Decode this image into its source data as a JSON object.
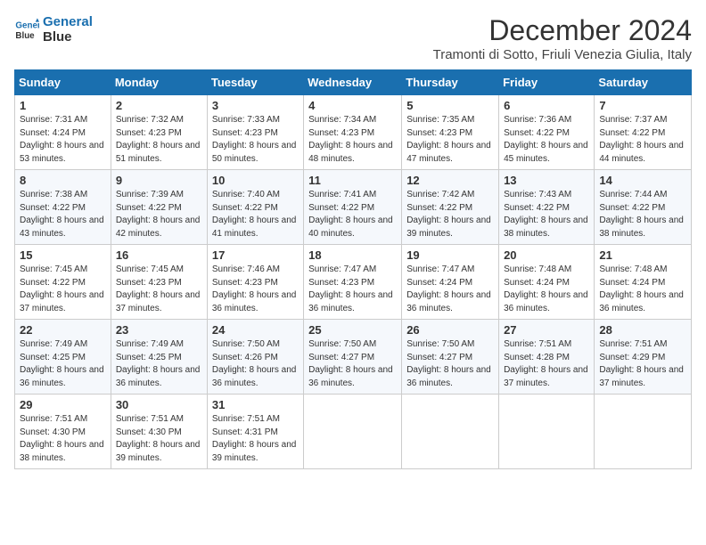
{
  "logo": {
    "line1": "General",
    "line2": "Blue"
  },
  "title": "December 2024",
  "subtitle": "Tramonti di Sotto, Friuli Venezia Giulia, Italy",
  "days_header": [
    "Sunday",
    "Monday",
    "Tuesday",
    "Wednesday",
    "Thursday",
    "Friday",
    "Saturday"
  ],
  "weeks": [
    [
      {
        "day": "1",
        "sunrise": "7:31 AM",
        "sunset": "4:24 PM",
        "daylight": "8 hours and 53 minutes."
      },
      {
        "day": "2",
        "sunrise": "7:32 AM",
        "sunset": "4:23 PM",
        "daylight": "8 hours and 51 minutes."
      },
      {
        "day": "3",
        "sunrise": "7:33 AM",
        "sunset": "4:23 PM",
        "daylight": "8 hours and 50 minutes."
      },
      {
        "day": "4",
        "sunrise": "7:34 AM",
        "sunset": "4:23 PM",
        "daylight": "8 hours and 48 minutes."
      },
      {
        "day": "5",
        "sunrise": "7:35 AM",
        "sunset": "4:23 PM",
        "daylight": "8 hours and 47 minutes."
      },
      {
        "day": "6",
        "sunrise": "7:36 AM",
        "sunset": "4:22 PM",
        "daylight": "8 hours and 45 minutes."
      },
      {
        "day": "7",
        "sunrise": "7:37 AM",
        "sunset": "4:22 PM",
        "daylight": "8 hours and 44 minutes."
      }
    ],
    [
      {
        "day": "8",
        "sunrise": "7:38 AM",
        "sunset": "4:22 PM",
        "daylight": "8 hours and 43 minutes."
      },
      {
        "day": "9",
        "sunrise": "7:39 AM",
        "sunset": "4:22 PM",
        "daylight": "8 hours and 42 minutes."
      },
      {
        "day": "10",
        "sunrise": "7:40 AM",
        "sunset": "4:22 PM",
        "daylight": "8 hours and 41 minutes."
      },
      {
        "day": "11",
        "sunrise": "7:41 AM",
        "sunset": "4:22 PM",
        "daylight": "8 hours and 40 minutes."
      },
      {
        "day": "12",
        "sunrise": "7:42 AM",
        "sunset": "4:22 PM",
        "daylight": "8 hours and 39 minutes."
      },
      {
        "day": "13",
        "sunrise": "7:43 AM",
        "sunset": "4:22 PM",
        "daylight": "8 hours and 38 minutes."
      },
      {
        "day": "14",
        "sunrise": "7:44 AM",
        "sunset": "4:22 PM",
        "daylight": "8 hours and 38 minutes."
      }
    ],
    [
      {
        "day": "15",
        "sunrise": "7:45 AM",
        "sunset": "4:22 PM",
        "daylight": "8 hours and 37 minutes."
      },
      {
        "day": "16",
        "sunrise": "7:45 AM",
        "sunset": "4:23 PM",
        "daylight": "8 hours and 37 minutes."
      },
      {
        "day": "17",
        "sunrise": "7:46 AM",
        "sunset": "4:23 PM",
        "daylight": "8 hours and 36 minutes."
      },
      {
        "day": "18",
        "sunrise": "7:47 AM",
        "sunset": "4:23 PM",
        "daylight": "8 hours and 36 minutes."
      },
      {
        "day": "19",
        "sunrise": "7:47 AM",
        "sunset": "4:24 PM",
        "daylight": "8 hours and 36 minutes."
      },
      {
        "day": "20",
        "sunrise": "7:48 AM",
        "sunset": "4:24 PM",
        "daylight": "8 hours and 36 minutes."
      },
      {
        "day": "21",
        "sunrise": "7:48 AM",
        "sunset": "4:24 PM",
        "daylight": "8 hours and 36 minutes."
      }
    ],
    [
      {
        "day": "22",
        "sunrise": "7:49 AM",
        "sunset": "4:25 PM",
        "daylight": "8 hours and 36 minutes."
      },
      {
        "day": "23",
        "sunrise": "7:49 AM",
        "sunset": "4:25 PM",
        "daylight": "8 hours and 36 minutes."
      },
      {
        "day": "24",
        "sunrise": "7:50 AM",
        "sunset": "4:26 PM",
        "daylight": "8 hours and 36 minutes."
      },
      {
        "day": "25",
        "sunrise": "7:50 AM",
        "sunset": "4:27 PM",
        "daylight": "8 hours and 36 minutes."
      },
      {
        "day": "26",
        "sunrise": "7:50 AM",
        "sunset": "4:27 PM",
        "daylight": "8 hours and 36 minutes."
      },
      {
        "day": "27",
        "sunrise": "7:51 AM",
        "sunset": "4:28 PM",
        "daylight": "8 hours and 37 minutes."
      },
      {
        "day": "28",
        "sunrise": "7:51 AM",
        "sunset": "4:29 PM",
        "daylight": "8 hours and 37 minutes."
      }
    ],
    [
      {
        "day": "29",
        "sunrise": "7:51 AM",
        "sunset": "4:30 PM",
        "daylight": "8 hours and 38 minutes."
      },
      {
        "day": "30",
        "sunrise": "7:51 AM",
        "sunset": "4:30 PM",
        "daylight": "8 hours and 39 minutes."
      },
      {
        "day": "31",
        "sunrise": "7:51 AM",
        "sunset": "4:31 PM",
        "daylight": "8 hours and 39 minutes."
      },
      null,
      null,
      null,
      null
    ]
  ]
}
